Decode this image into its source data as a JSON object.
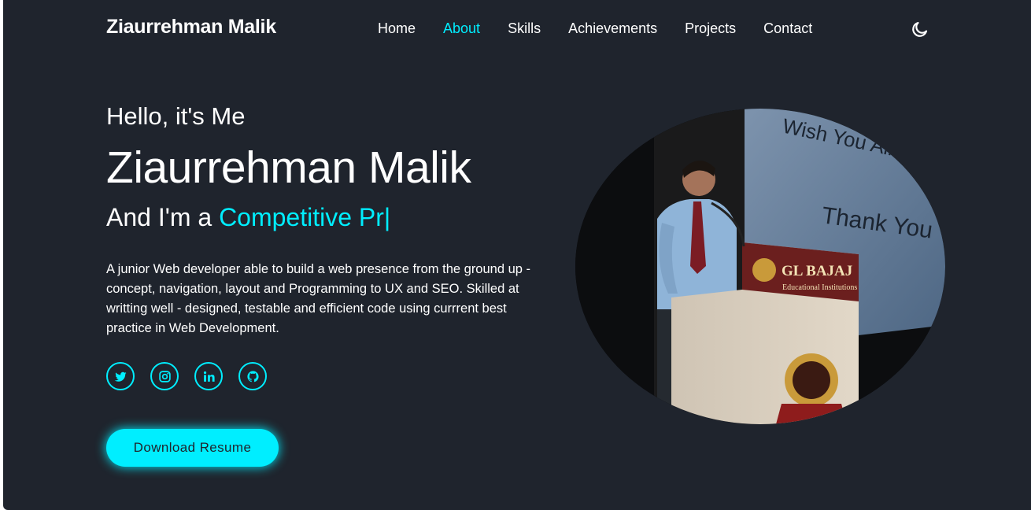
{
  "header": {
    "logo": "Ziaurrehman Malik",
    "nav": [
      {
        "label": "Home"
      },
      {
        "label": "About"
      },
      {
        "label": "Skills"
      },
      {
        "label": "Achievements"
      },
      {
        "label": "Projects"
      },
      {
        "label": "Contact"
      }
    ],
    "active_nav": "About",
    "theme_icon": "moon-icon"
  },
  "hero": {
    "greeting": "Hello, it's Me",
    "name": "Ziaurrehman Malik",
    "role_prefix": "And I'm a",
    "role_typed": "Competitive Pr",
    "cursor": "|",
    "description": "A junior Web developer able to build a web presence from the ground up - concept, navigation, layout and Programming to UX and SEO. Skilled at writting well - designed, testable and efficient code using currrent best practice in Web Development.",
    "socials": [
      "twitter-icon",
      "instagram-icon",
      "linkedin-icon",
      "github-icon"
    ],
    "button_label": "Download Resume"
  },
  "photo": {
    "screen_line1": "Wish You All The Best",
    "screen_line2": "Thank You",
    "podium_brand": "GL BAJAJ",
    "podium_sub": "Educational Institutions"
  },
  "colors": {
    "background": "#1f242d",
    "accent": "#00eeff",
    "text": "#ffffff"
  }
}
